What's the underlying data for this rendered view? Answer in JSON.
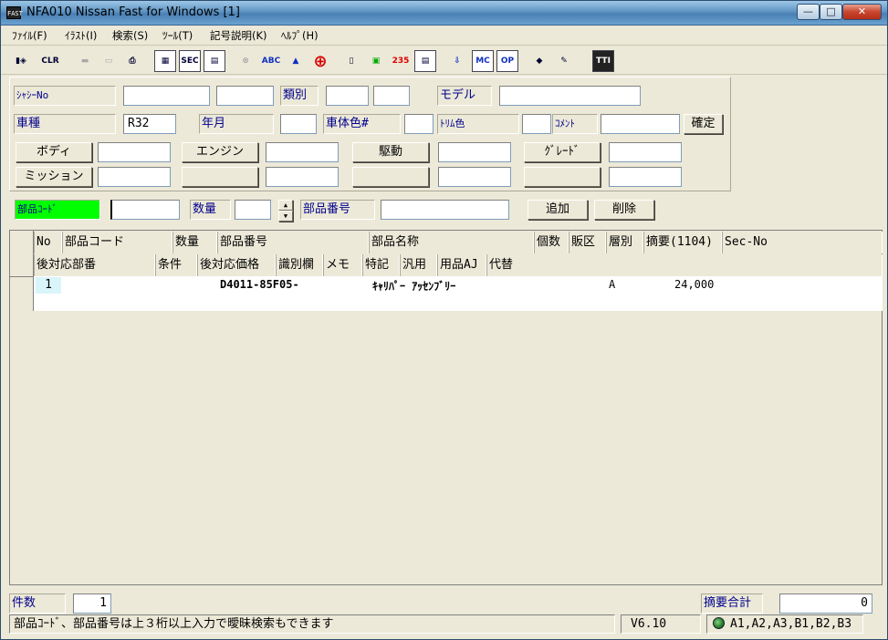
{
  "window": {
    "title": "NFA010 Nissan Fast for Windows [1]",
    "app_icon": "FAST",
    "min": "—",
    "max": "□",
    "close": "✕"
  },
  "menu": [
    "ﾌｧｲﾙ(F)",
    "ｲﾗｽﾄ(I)",
    "検索(S)",
    "ﾂｰﾙ(T)",
    "記号説明(K)",
    "ﾍﾙﾌﾟ(H)"
  ],
  "toolbar": {
    "b0": "▮◈",
    "b1": "CLR",
    "b2": "▬",
    "b3": "▭",
    "b4": "⎙",
    "b5": "▦",
    "b6": "SEC",
    "b7": "▤",
    "b8": "⊗",
    "b9": "ABC",
    "b10": "▲",
    "b11": "⊕",
    "b12": "▯",
    "b13": "▣",
    "b14": "235",
    "b15": "▤",
    "b16": "⇩",
    "b17": "MC",
    "b18": "OP",
    "b19": "◆",
    "b20": "✎",
    "b21": "TTI"
  },
  "form": {
    "chassis_label": "ｼｬｼｰNo",
    "chassis_1": "",
    "chassis_2": "",
    "ruibetsu_label": "類別",
    "ruibetsu_1": "",
    "ruibetsu_2": "",
    "model_label": "モデル",
    "model_value": "",
    "shashu_label": "車種",
    "shashu_value": "R32",
    "nengetsu_label": "年月",
    "nengetsu_value": "",
    "body_color_label": "車体色#",
    "body_color_value": "",
    "trim_label": "ﾄﾘﾑ色",
    "trim_value": "",
    "comment_label": "ｺﾒﾝﾄ",
    "comment_value": "",
    "confirm_button": "確定",
    "body_button": "ボディ",
    "body_value": "",
    "engine_button": "エンジン",
    "engine_value": "",
    "drive_button": "駆動",
    "drive_value": "",
    "grade_button": "ｸﾞﾚｰﾄﾞ",
    "grade_value": "",
    "mission_button": "ミッション",
    "mission_value": ""
  },
  "parts": {
    "code_label": "部品ｺｰﾄﾞ",
    "code_value": "",
    "qty_label": "数量",
    "qty_value": "",
    "number_label": "部品番号",
    "number_value": "",
    "add_button": "追加",
    "delete_button": "削除",
    "spin_up": "▲",
    "spin_down": "▼"
  },
  "grid": {
    "header1": [
      "No",
      "部品コード",
      "数量",
      "部品番号",
      "部品名称",
      "個数",
      "販区",
      "層別",
      "摘要(1104)",
      "Sec-No"
    ],
    "header2": [
      "後対応部番",
      "条件",
      "後対応価格",
      "識別欄",
      "メモ",
      "特記",
      "汎用",
      "用品AJ",
      "代替"
    ],
    "rows": [
      {
        "no": "1",
        "part_number": "D4011-85F05-",
        "name": "ｷｬﾘﾊﾟｰ ｱｯｾﾝﾌﾞﾘｰ",
        "layer": "A",
        "summary": "24,000"
      }
    ]
  },
  "footer": {
    "count_label": "件数",
    "count_value": "1",
    "summary_total_label": "摘要合計",
    "summary_total_value": "0"
  },
  "status": {
    "message": "部品ｺｰﾄﾞ、部品番号は上３桁以上入力で曖昧検索もできます",
    "version": "V6.10",
    "regions": "A1,A2,A3,B1,B2,B3"
  }
}
